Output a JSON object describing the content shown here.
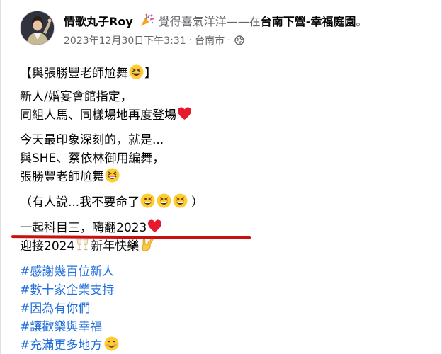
{
  "post": {
    "author": "情歌丸子Roy",
    "feeling": "覺得喜氣洋洋——在",
    "location": "台南下營-幸福庭園",
    "period": "。",
    "timestamp": "2023年12月30日下午3:31",
    "place": "台南市",
    "sep": "·",
    "icons": {
      "feeling": "confetti-icon",
      "privacy": "globe-icon"
    }
  },
  "body": {
    "l1a": "【與張勝豐老師尬舞",
    "l1b": "】",
    "l2": "新人/婚宴會館指定，",
    "l3": "同組人馬、同樣場地再度登場",
    "l4": "今天最印象深刻的，就是...",
    "l5": "與SHE、蔡依林御用編舞，",
    "l6": "張勝豐老師尬舞",
    "l7a": "（有人說...我不要命了",
    "l7b": "）",
    "l8": "一起科目三，嗨翻2023",
    "l9a": "迎接2024",
    "l9b": "新年快樂",
    "tags": [
      "#感謝幾百位新人",
      "#數十家企業支持",
      "#因為有你們",
      "#讓歡樂與幸福",
      "#充滿更多地方"
    ]
  },
  "colors": {
    "text": "#050505",
    "secondary": "#65676b",
    "hashtag": "#216fdb",
    "annotation": "#c81010"
  }
}
